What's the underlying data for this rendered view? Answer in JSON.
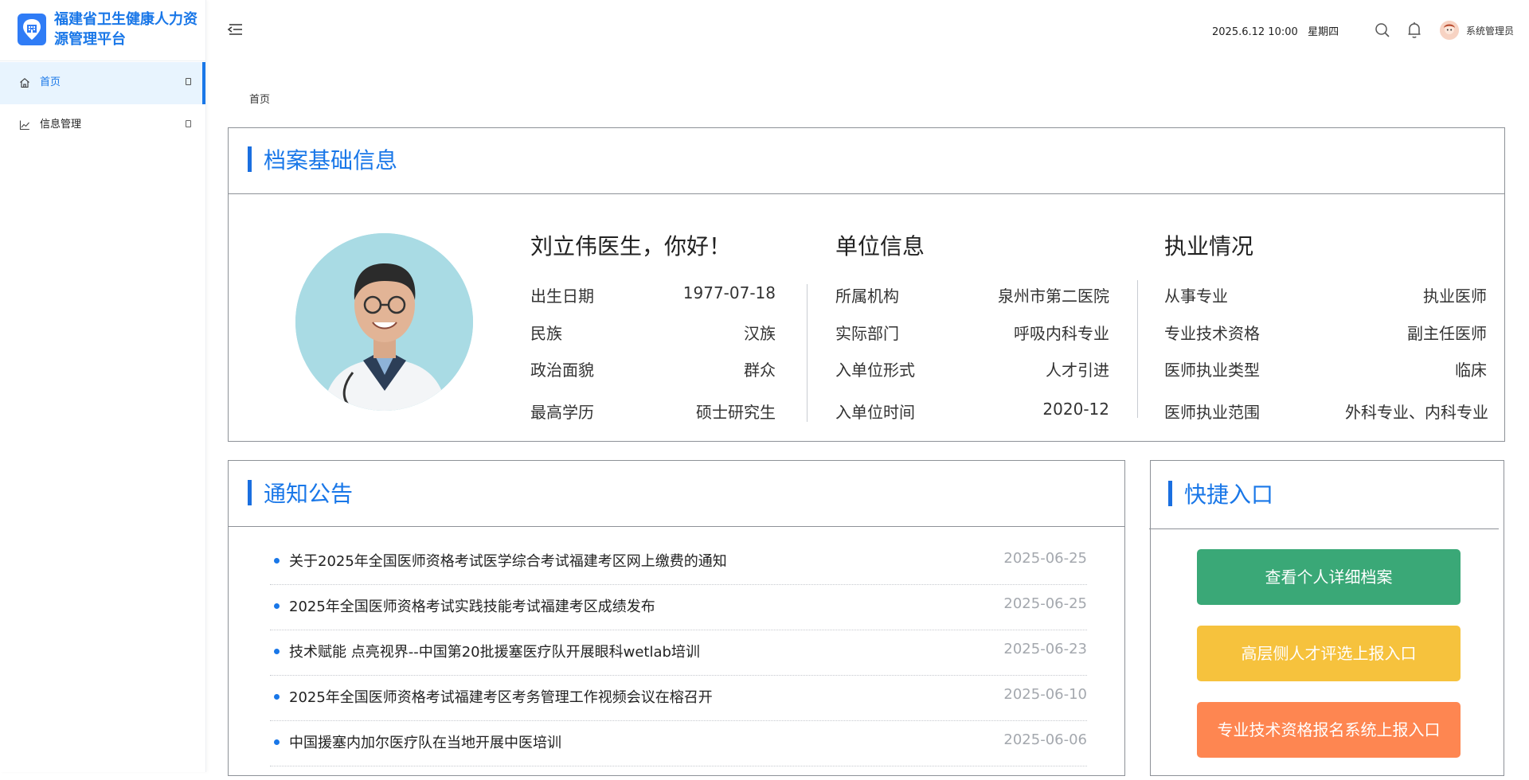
{
  "app": {
    "title": "福建省卫生健康人力资源管理平台"
  },
  "sidebar": {
    "items": [
      {
        "label": "首页",
        "icon": "home-icon",
        "active": true
      },
      {
        "label": "信息管理",
        "icon": "chart-line-icon",
        "active": false
      }
    ]
  },
  "header": {
    "datetime": "2025.6.12 10:00",
    "weekday": "星期四",
    "user": "系统管理员"
  },
  "breadcrumb": "首页",
  "profile": {
    "section_title": "档案基础信息",
    "greeting": "刘立伟医生，你好！",
    "personal": [
      {
        "label": "出生日期",
        "value": "1977-07-18"
      },
      {
        "label": "民族",
        "value": "汉族"
      },
      {
        "label": "政治面貌",
        "value": "群众"
      },
      {
        "label": "最高学历",
        "value": "硕士研究生"
      }
    ],
    "unit_title": "单位信息",
    "unit": [
      {
        "label": "所属机构",
        "value": "泉州市第二医院"
      },
      {
        "label": "实际部门",
        "value": "呼吸内科专业"
      },
      {
        "label": "入单位形式",
        "value": "人才引进"
      },
      {
        "label": "入单位时间",
        "value": "2020-12"
      }
    ],
    "practice_title": "执业情况",
    "practice": [
      {
        "label": "从事专业",
        "value": "执业医师"
      },
      {
        "label": "专业技术资格",
        "value": "副主任医师"
      },
      {
        "label": "医师执业类型",
        "value": "临床"
      },
      {
        "label": "医师执业范围",
        "value": "外科专业、内科专业"
      }
    ]
  },
  "notices": {
    "title": "通知公告",
    "items": [
      {
        "title": "关于2025年全国医师资格考试医学综合考试福建考区网上缴费的通知",
        "date": "2025-06-25"
      },
      {
        "title": "2025年全国医师资格考试实践技能考试福建考区成绩发布",
        "date": "2025-06-25"
      },
      {
        "title": "技术赋能 点亮视界--中国第20批援塞医疗队开展眼科wetlab培训",
        "date": "2025-06-23"
      },
      {
        "title": "2025年全国医师资格考试福建考区考务管理工作视频会议在榕召开",
        "date": "2025-06-10"
      },
      {
        "title": "中国援塞内加尔医疗队在当地开展中医培训",
        "date": "2025-06-06"
      }
    ]
  },
  "quick": {
    "title": "快捷入口",
    "buttons": [
      {
        "label": "查看个人详细档案",
        "color": "#3aa877"
      },
      {
        "label": "高层侧人才评选上报入口",
        "color": "#f6c23d"
      },
      {
        "label": "专业技术资格报名系统上报入口",
        "color": "#fe8651"
      }
    ]
  },
  "colors": {
    "accent": "#1977e8",
    "active_bg": "#e8f4fe"
  }
}
